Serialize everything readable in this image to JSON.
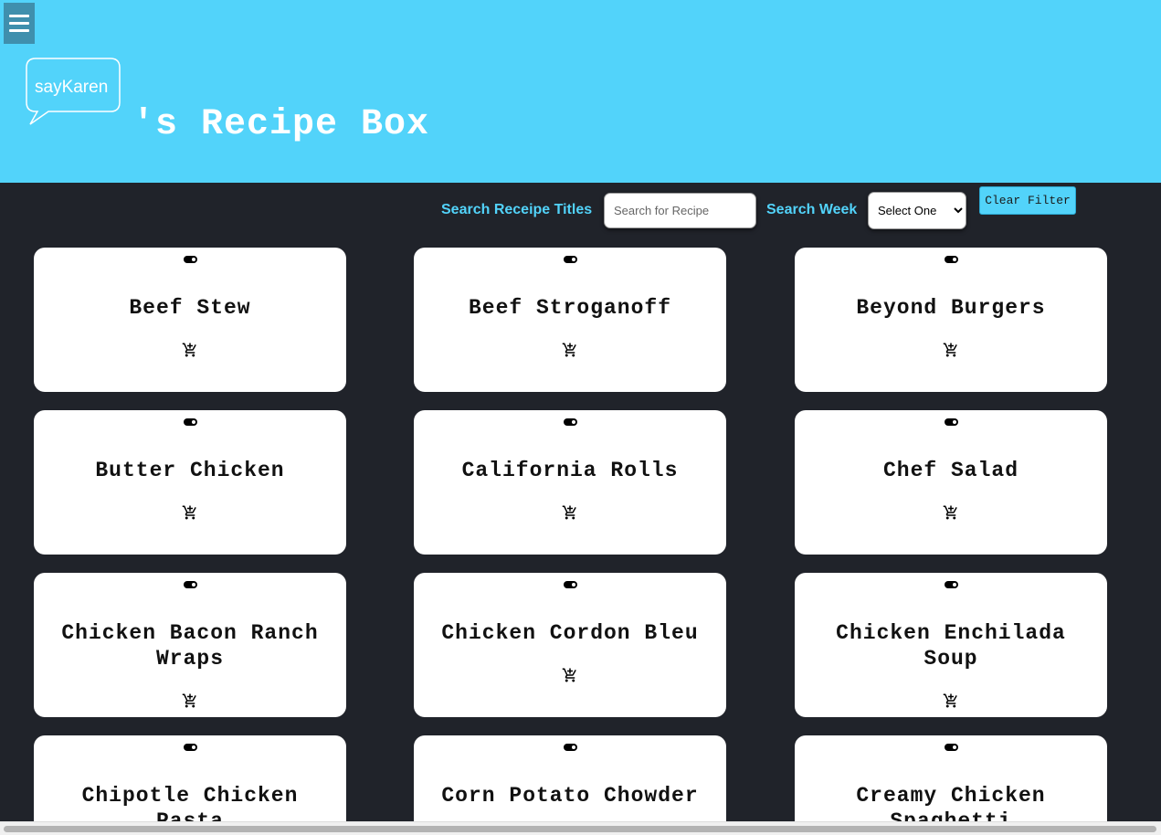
{
  "header": {
    "logo_text": "sayKaren",
    "title": "'s Recipe Box"
  },
  "search": {
    "title_label": "Search Receipe Titles",
    "title_placeholder": "Search for Recipe",
    "week_label": "Search Week",
    "week_selected": "Select One",
    "clear_label": "Clear Filter"
  },
  "colors": {
    "header_bg": "#52d3fa",
    "page_bg": "#20232a",
    "card_bg": "#ffffff",
    "accent": "#52d3fa"
  },
  "recipes": [
    {
      "title": "Beef Stew"
    },
    {
      "title": "Beef Stroganoff"
    },
    {
      "title": "Beyond Burgers"
    },
    {
      "title": "Butter Chicken"
    },
    {
      "title": "California Rolls"
    },
    {
      "title": "Chef Salad"
    },
    {
      "title": "Chicken Bacon Ranch Wraps"
    },
    {
      "title": "Chicken Cordon Bleu"
    },
    {
      "title": "Chicken Enchilada Soup"
    },
    {
      "title": "Chipotle Chicken Pasta"
    },
    {
      "title": "Corn Potato Chowder"
    },
    {
      "title": "Creamy Chicken Spaghetti"
    }
  ],
  "icons": {
    "menu": "hamburger-menu-icon",
    "toggle": "toggle-icon",
    "cart": "add-to-cart-icon"
  }
}
